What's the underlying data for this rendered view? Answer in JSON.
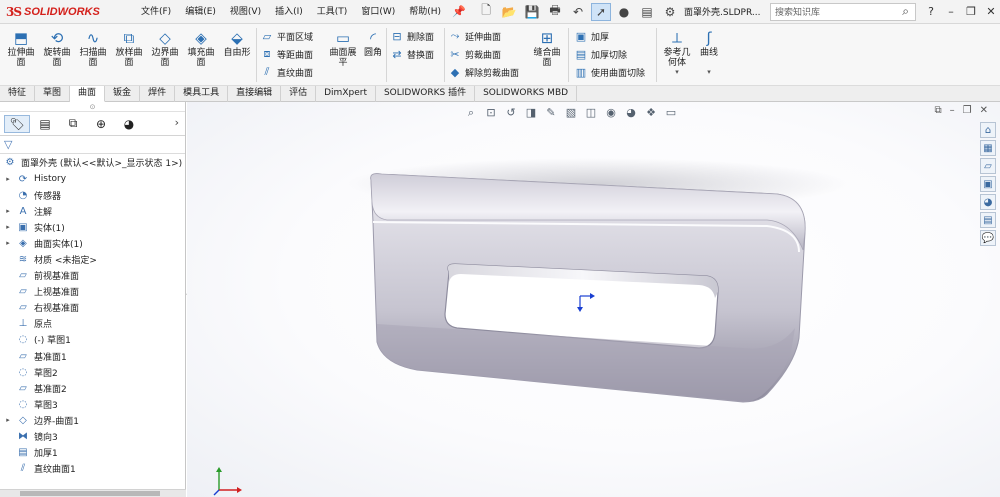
{
  "app": {
    "logo_mark": "3S",
    "logo_text": "SOLIDWORKS",
    "document_title": "面罩外壳.SLDPR...",
    "search_placeholder": "搜索知识库"
  },
  "menu": [
    "文件(F)",
    "编辑(E)",
    "视图(V)",
    "插入(I)",
    "工具(T)",
    "窗口(W)",
    "帮助(H)"
  ],
  "quick_access": [
    "new-icon",
    "open-icon",
    "save-icon",
    "print-icon",
    "undo-icon",
    "select-icon",
    "traffic-light-icon",
    "options-icon"
  ],
  "ribbon": {
    "big": [
      {
        "label": "拉伸曲\n面",
        "icon": "extrude-surface-icon"
      },
      {
        "label": "旋转曲\n面",
        "icon": "revolve-surface-icon"
      },
      {
        "label": "扫描曲\n面",
        "icon": "sweep-surface-icon"
      },
      {
        "label": "放样曲\n面",
        "icon": "loft-surface-icon"
      },
      {
        "label": "边界曲\n面",
        "icon": "boundary-surface-icon"
      },
      {
        "label": "填充曲\n面",
        "icon": "fill-surface-icon"
      },
      {
        "label": "自由形",
        "icon": "freeform-icon"
      },
      {
        "label": "曲面展\n平",
        "icon": "flatten-surface-icon"
      },
      {
        "label": "圆角",
        "icon": "fillet-icon"
      },
      {
        "label": "缝合曲\n面",
        "icon": "knit-surface-icon"
      },
      {
        "label": "参考几\n何体",
        "icon": "reference-geometry-icon"
      },
      {
        "label": "曲线",
        "icon": "curves-icon"
      }
    ],
    "small_col1": [
      "平面区域",
      "等距曲面",
      "直纹曲面"
    ],
    "small_col2": [
      "删除面",
      "替换面"
    ],
    "small_col3": [
      "延伸曲面",
      "剪裁曲面",
      "解除剪裁曲面"
    ],
    "small_col4": [
      "加厚",
      "加厚切除",
      "使用曲面切除"
    ]
  },
  "tabs": [
    "特征",
    "草图",
    "曲面",
    "钣金",
    "焊件",
    "模具工具",
    "直接编辑",
    "评估",
    "DimXpert",
    "SOLIDWORKS 插件",
    "SOLIDWORKS MBD"
  ],
  "active_tab": "曲面",
  "tree": {
    "root": "面罩外壳 (默认<<默认>_显示状态 1>)",
    "items": [
      {
        "label": "History",
        "expand": true,
        "icon": "history-icon"
      },
      {
        "label": "传感器",
        "expand": false,
        "icon": "sensor-icon"
      },
      {
        "label": "注解",
        "expand": true,
        "icon": "annotation-icon"
      },
      {
        "label": "实体(1)",
        "expand": true,
        "icon": "solid-body-icon"
      },
      {
        "label": "曲面实体(1)",
        "expand": true,
        "icon": "surface-body-icon"
      },
      {
        "label": "材质 <未指定>",
        "expand": false,
        "icon": "material-icon"
      },
      {
        "label": "前视基准面",
        "expand": false,
        "icon": "plane-icon"
      },
      {
        "label": "上视基准面",
        "expand": false,
        "icon": "plane-icon"
      },
      {
        "label": "右视基准面",
        "expand": false,
        "icon": "plane-icon"
      },
      {
        "label": "原点",
        "expand": false,
        "icon": "origin-icon"
      },
      {
        "label": "(-) 草图1",
        "expand": false,
        "icon": "sketch-icon"
      },
      {
        "label": "基准面1",
        "expand": false,
        "icon": "plane-icon"
      },
      {
        "label": "草图2",
        "expand": false,
        "icon": "sketch-icon"
      },
      {
        "label": "基准面2",
        "expand": false,
        "icon": "plane-icon"
      },
      {
        "label": "草图3",
        "expand": false,
        "icon": "sketch-icon"
      },
      {
        "label": "边界-曲面1",
        "expand": true,
        "icon": "boundary-surface-icon"
      },
      {
        "label": "镜向3",
        "expand": false,
        "icon": "mirror-icon"
      },
      {
        "label": "加厚1",
        "expand": false,
        "icon": "thicken-icon"
      },
      {
        "label": "直纹曲面1",
        "expand": false,
        "icon": "ruled-surface-icon"
      }
    ]
  },
  "colors": {
    "accent": "#2d70b3",
    "logo": "#d4201b"
  }
}
